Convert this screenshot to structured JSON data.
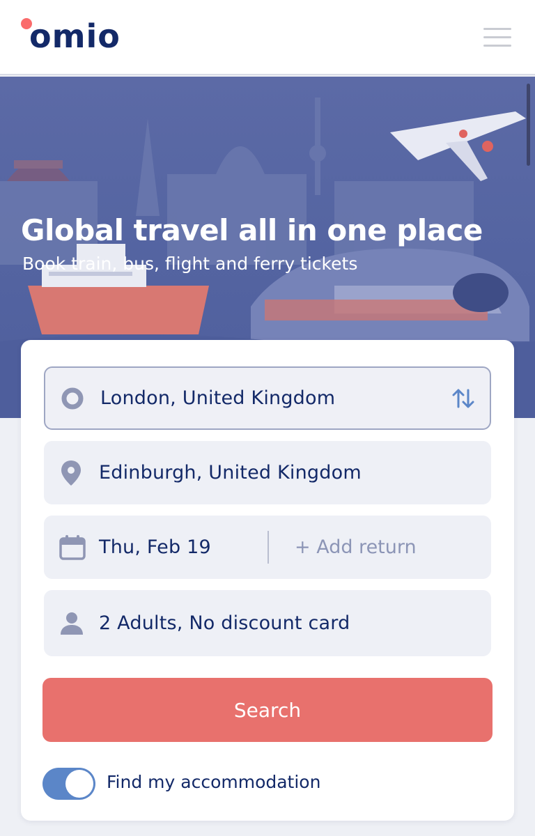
{
  "header": {
    "logo_text": "omio",
    "menu_icon": "hamburger-menu-icon"
  },
  "hero": {
    "title": "Global travel all in one place",
    "subtitle": "Book train, bus, flight and ferry tickets"
  },
  "search_form": {
    "origin": {
      "value": "London, United Kingdom",
      "icon": "origin-circle-icon"
    },
    "swap_icon": "swap-arrows-icon",
    "destination": {
      "value": "Edinburgh, United Kingdom",
      "icon": "location-pin-icon"
    },
    "date": {
      "value": "Thu, Feb 19",
      "icon": "calendar-icon",
      "return_label": "+ Add return"
    },
    "passengers": {
      "value": "2 Adults, No discount card",
      "icon": "person-icon"
    },
    "search_button_label": "Search",
    "accommodation_toggle": {
      "label": "Find my accommodation",
      "on": true
    }
  },
  "colors": {
    "brand_navy": "#132968",
    "brand_coral": "#fa6b6b",
    "search_button": "#e8716d",
    "toggle_on": "#5b86c8",
    "hero_bg": "#5565a2"
  }
}
